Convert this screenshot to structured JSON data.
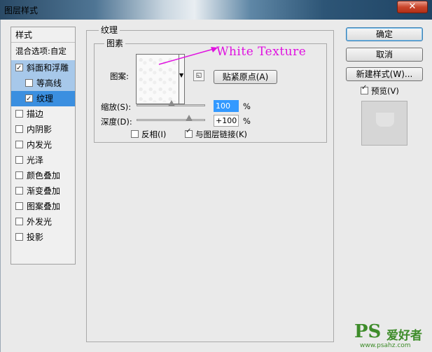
{
  "window": {
    "title": "图层样式",
    "close_glyph": "✕"
  },
  "styles_panel": {
    "header": "样式",
    "blend_options": "混合选项:自定",
    "items": [
      {
        "label": "斜面和浮雕",
        "checked": true
      },
      {
        "label": "等高线",
        "checked": false
      },
      {
        "label": "纹理",
        "checked": true
      },
      {
        "label": "描边",
        "checked": false
      },
      {
        "label": "内阴影",
        "checked": false
      },
      {
        "label": "内发光",
        "checked": false
      },
      {
        "label": "光泽",
        "checked": false
      },
      {
        "label": "颜色叠加",
        "checked": false
      },
      {
        "label": "渐变叠加",
        "checked": false
      },
      {
        "label": "图案叠加",
        "checked": false
      },
      {
        "label": "外发光",
        "checked": false
      },
      {
        "label": "投影",
        "checked": false
      }
    ]
  },
  "texture": {
    "group_title": "纹理",
    "subgroup_title": "图素",
    "pattern_label": "图案:",
    "snap_button": "贴紧原点(A)",
    "scale_label": "缩放(S):",
    "scale_value": "100",
    "scale_unit": "%",
    "depth_label": "深度(D):",
    "depth_value": "+100",
    "depth_unit": "%",
    "invert_label": "反相(I)",
    "invert_checked": false,
    "link_label": "与图层链接(K)",
    "link_checked": true
  },
  "annotation": "White Texture",
  "buttons": {
    "ok": "确定",
    "cancel": "取消",
    "new_style": "新建样式(W)...",
    "preview_label": "预览(V)",
    "preview_checked": true
  },
  "watermark": {
    "brand": "PS",
    "cn": "爱好者",
    "url": "www.psahz.com"
  },
  "colors": {
    "selection_light": "#a7c8ea",
    "selection_dark": "#3b8fe0",
    "annotation": "#e010e0"
  }
}
